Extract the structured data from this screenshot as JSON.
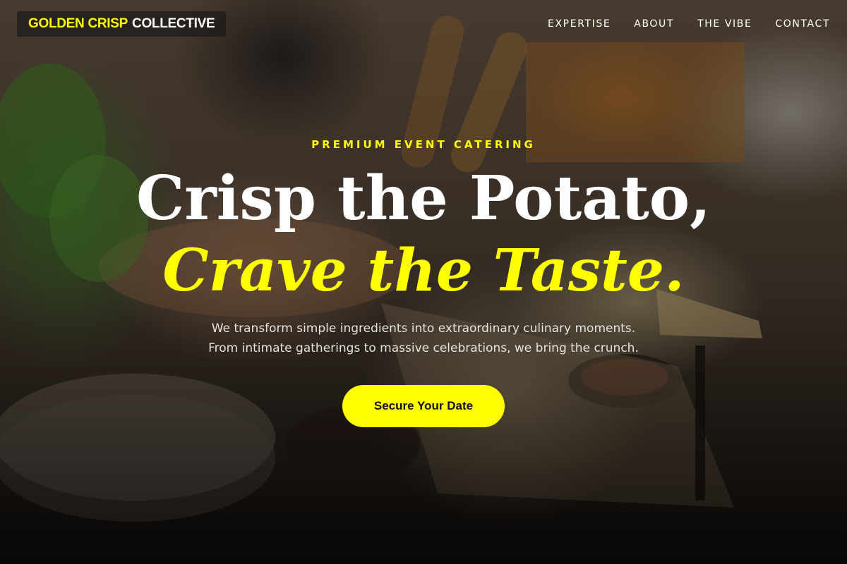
{
  "brand": {
    "logo_accent": "GOLDEN CRISP",
    "logo_rest": "COLLECTIVE",
    "accent_color": "#ffff00"
  },
  "nav": {
    "items": [
      {
        "label": "EXPERTISE"
      },
      {
        "label": "ABOUT"
      },
      {
        "label": "THE VIBE"
      },
      {
        "label": "CONTACT"
      }
    ]
  },
  "hero": {
    "eyebrow": "PREMIUM EVENT CATERING",
    "headline_line1": "Crisp the Potato,",
    "headline_line2": "Crave the Taste.",
    "subtext_line1": "We transform simple ingredients into extraordinary culinary moments.",
    "subtext_line2": "From intimate gatherings to massive celebrations, we bring the crunch.",
    "cta_label": "Secure Your Date"
  }
}
